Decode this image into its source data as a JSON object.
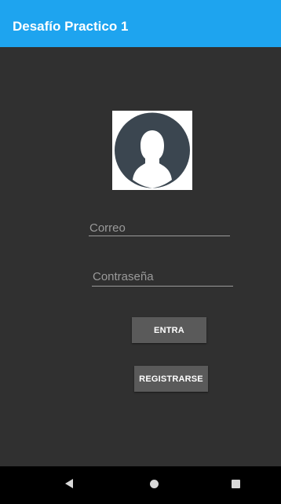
{
  "app_bar": {
    "title": "Desafío Practico 1",
    "color": "#1ea4ef"
  },
  "login": {
    "avatar_icon": "user-profile-icon",
    "email_placeholder": "Correo",
    "password_placeholder": "Contraseña",
    "enter_label": "ENTRA",
    "register_label": "REGISTRARSE"
  },
  "navigation_bar": {
    "back_icon": "back-icon",
    "home_icon": "home-icon",
    "recent_icon": "recent-apps-icon"
  },
  "colors": {
    "background": "#303030",
    "button": "#5a5a5a",
    "hint_text": "#9a9a9a"
  }
}
